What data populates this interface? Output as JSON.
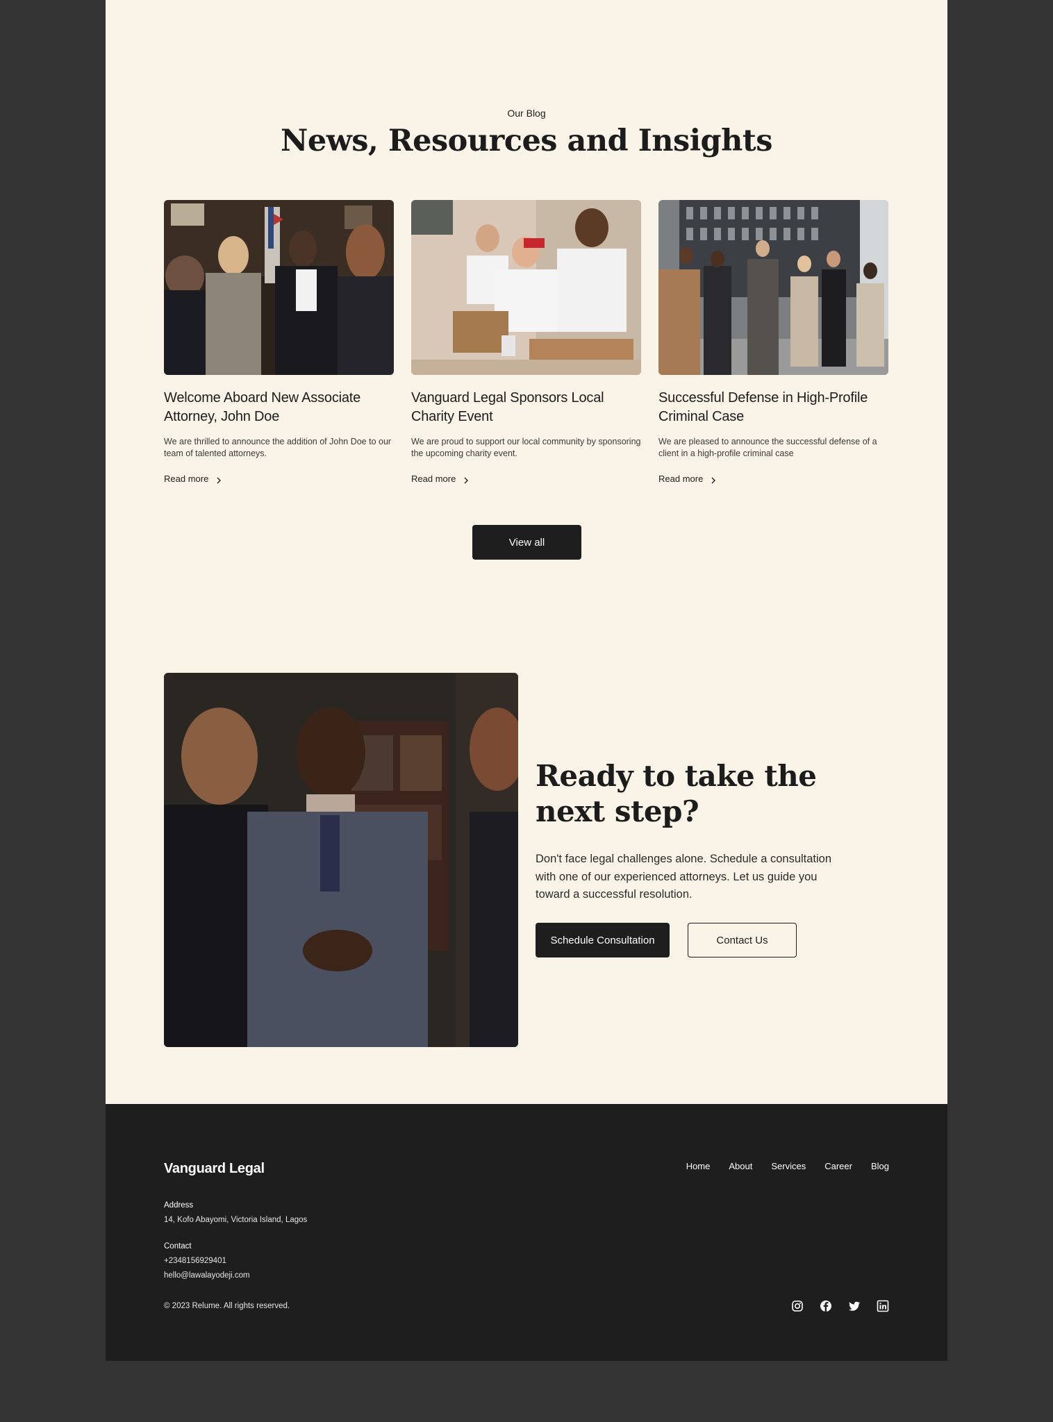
{
  "blog": {
    "eyebrow": "Our Blog",
    "title": "News, Resources and Insights",
    "posts": [
      {
        "title": "Welcome Aboard New Associate Attorney, John Doe",
        "description": "We are thrilled to announce the addition of John Doe to our team of talented attorneys.",
        "link": "Read more"
      },
      {
        "title": "Vanguard Legal Sponsors Local Charity Event",
        "description": "We are proud to support our local community by sponsoring the upcoming charity event.",
        "link": "Read more"
      },
      {
        "title": "Successful Defense in High-Profile Criminal Case",
        "description": "We are pleased to announce the successful defense of a client in a high-profile criminal case",
        "link": "Read more"
      }
    ],
    "view_all": "View all"
  },
  "cta": {
    "title": "Ready to take the next step?",
    "text": "Don't face legal challenges alone. Schedule a consultation with one of our experienced attorneys. Let us guide you toward a successful resolution.",
    "primary": "Schedule Consultation",
    "secondary": "Contact Us"
  },
  "footer": {
    "logo": "Vanguard Legal",
    "nav": [
      "Home",
      "About",
      "Services",
      "Career",
      "Blog"
    ],
    "address_label": "Address",
    "address": "14, Kofo Abayomi, Victoria Island, Lagos",
    "contact_label": "Contact",
    "phone": "+2348156929401",
    "email": "hello@lawalayodeji.com",
    "copyright": "© 2023 Relume. All rights reserved.",
    "social_icons": [
      "instagram-icon",
      "facebook-icon",
      "twitter-icon",
      "linkedin-icon"
    ]
  },
  "colors": {
    "background": "#333333",
    "cream": "#f9f4e7",
    "dark": "#1e1e1e"
  }
}
